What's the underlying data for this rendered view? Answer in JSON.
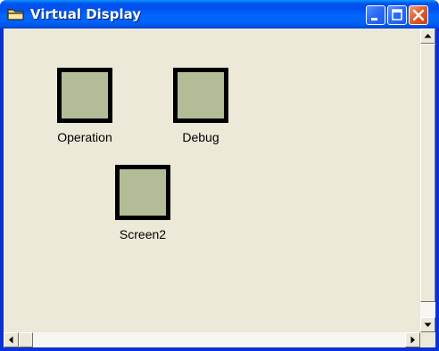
{
  "window": {
    "title": "Virtual Display",
    "icon": "folder-icon",
    "controls": [
      "minimize-icon",
      "maximize-icon",
      "close-icon"
    ]
  },
  "displays": [
    {
      "label": "Operation",
      "icon": "display-screen-icon"
    },
    {
      "label": "Debug",
      "icon": "display-screen-icon"
    },
    {
      "label": "Screen2",
      "icon": "display-screen-icon"
    }
  ],
  "colors": {
    "titlebar": "#0058ee",
    "client_background": "#ece9d8",
    "screen_fill": "#b3bc97",
    "screen_border": "#000000",
    "close_button": "#e55e2e"
  }
}
